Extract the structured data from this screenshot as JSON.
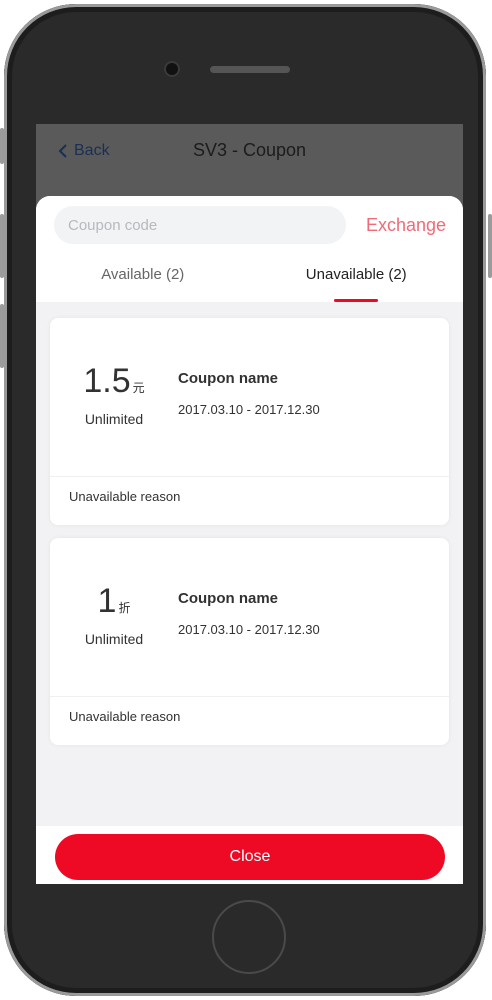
{
  "nav": {
    "back_label": "Back",
    "title": "SV3 - Coupon"
  },
  "exchange": {
    "placeholder": "Coupon code",
    "button_label": "Exchange"
  },
  "tabs": [
    {
      "label": "Available (2)",
      "active": false
    },
    {
      "label": "Unavailable (2)",
      "active": true
    }
  ],
  "coupons": [
    {
      "value": "1.5",
      "unit": "元",
      "condition": "Unlimited",
      "name": "Coupon name",
      "date_range": "2017.03.10 - 2017.12.30",
      "reason": "Unavailable reason"
    },
    {
      "value": "1",
      "unit": "折",
      "condition": "Unlimited",
      "name": "Coupon name",
      "date_range": "2017.03.10 - 2017.12.30",
      "reason": "Unavailable reason"
    }
  ],
  "footer": {
    "close_label": "Close"
  },
  "colors": {
    "accent_red": "#ee0a24",
    "exchange_text": "#f06a78"
  }
}
